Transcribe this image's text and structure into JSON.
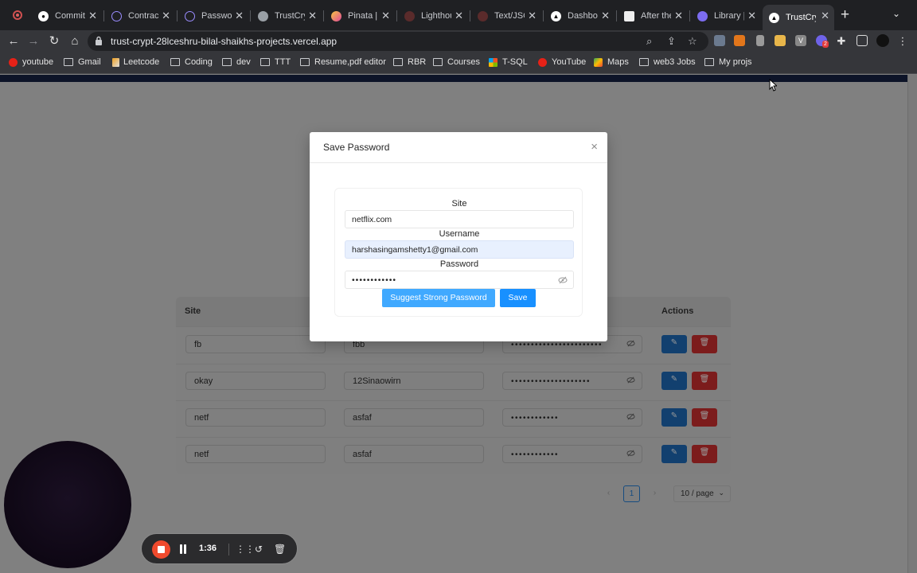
{
  "browser": {
    "tabs": [
      {
        "label": "Commits"
      },
      {
        "label": "Contract"
      },
      {
        "label": "Password"
      },
      {
        "label": "TrustCrypt"
      },
      {
        "label": "Pinata | I"
      },
      {
        "label": "Lighthouse"
      },
      {
        "label": "Text/JSON"
      },
      {
        "label": "Dashboard"
      },
      {
        "label": "After the"
      },
      {
        "label": "Library |"
      },
      {
        "label": "TrustCrypt"
      }
    ],
    "url": "trust-crypt-28lceshru-bilal-shaikhs-projects.vercel.app",
    "extension_badge": "2",
    "bookmarks": [
      "youtube",
      "Gmail",
      "Leetcode",
      "Coding",
      "dev",
      "TTT",
      "Resume,pdf editor",
      "RBR",
      "Courses",
      "T-SQL",
      "YouTube",
      "Maps",
      "web3 Jobs",
      "My projs"
    ]
  },
  "table": {
    "headers": {
      "site": "Site",
      "actions": "Actions"
    },
    "rows": [
      {
        "site": "fb",
        "username": "fbb",
        "password": "•••••••••••••••••••••••"
      },
      {
        "site": "okay",
        "username": "12Sinaowirn",
        "password": "••••••••••••••••••••"
      },
      {
        "site": "netf",
        "username": "asfaf",
        "password": "••••••••••••"
      },
      {
        "site": "netf",
        "username": "asfaf",
        "password": "••••••••••••"
      }
    ]
  },
  "pagination": {
    "prev": "‹",
    "current": "1",
    "next": "›",
    "page_size": "10 / page"
  },
  "modal": {
    "title": "Save Password",
    "close": "×",
    "site_label": "Site",
    "site_value": "netflix.com",
    "username_label": "Username",
    "username_value": "harshasingamshetty1@gmail.com",
    "password_label": "Password",
    "password_value": "••••••••••••",
    "suggest_button": "Suggest Strong Password",
    "save_button": "Save"
  },
  "recorder": {
    "time": "1:36"
  },
  "colors": {
    "primary": "#1890ff",
    "suggest": "#40a9ff",
    "danger": "#ff4d4f",
    "record": "#f04a2d"
  }
}
